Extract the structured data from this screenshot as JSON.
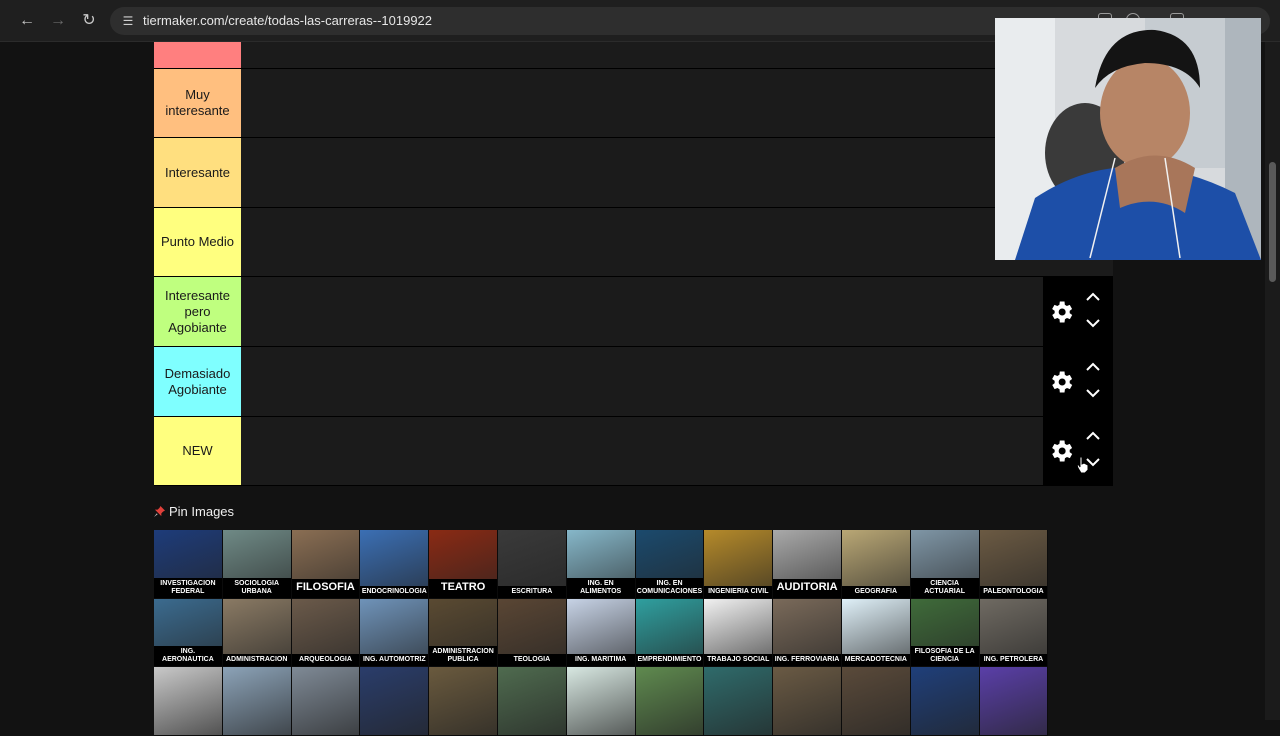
{
  "browser": {
    "url": "tiermaker.com/create/todas-las-carreras--1019922",
    "colors": {
      "chrome_bg": "#1f1f1f",
      "omnibox": "#2e2e2e"
    }
  },
  "tiers": [
    {
      "label": "",
      "color": "#ff7f7f",
      "controls_visible": false
    },
    {
      "label": "Muy interesante",
      "color": "#ffbf7f",
      "controls_visible": false
    },
    {
      "label": "Interesante",
      "color": "#ffdf7f",
      "controls_visible": false
    },
    {
      "label": "Punto Medio",
      "color": "#ffff7f",
      "controls_visible": false
    },
    {
      "label": "Interesante pero Agobiante",
      "color": "#bfff7f",
      "controls_visible": true
    },
    {
      "label": "Demasiado Agobiante",
      "color": "#7fffff",
      "controls_visible": true
    },
    {
      "label": "NEW",
      "color": "#ffff7f",
      "controls_visible": true
    }
  ],
  "pin_images_label": "Pin Images",
  "images": [
    {
      "caption": "INVESTIGACION FEDERAL",
      "bg": "#1e3c7a",
      "big": false
    },
    {
      "caption": "SOCIOLOGIA URBANA",
      "bg": "#6f8a86",
      "big": false
    },
    {
      "caption": "FILOSOFIA",
      "bg": "#8a6e53",
      "big": true
    },
    {
      "caption": "ENDOCRINOLOGIA",
      "bg": "#3b6fb4",
      "big": false
    },
    {
      "caption": "TEATRO",
      "bg": "#8a2a14",
      "big": true
    },
    {
      "caption": "ESCRITURA",
      "bg": "#3a3a3a",
      "big": false
    },
    {
      "caption": "ING. EN ALIMENTOS",
      "bg": "#86b7c9",
      "big": false
    },
    {
      "caption": "ING. EN COMUNICACIONES",
      "bg": "#1b4a6d",
      "big": false
    },
    {
      "caption": "INGENIERIA CIVIL",
      "bg": "#b58a2a",
      "big": false
    },
    {
      "caption": "AUDITORIA",
      "bg": "#a9a9a9",
      "big": true
    },
    {
      "caption": "GEOGRAFIA",
      "bg": "#b9a775",
      "big": false
    },
    {
      "caption": "CIENCIA ACTUARIAL",
      "bg": "#7f96a6",
      "big": false
    },
    {
      "caption": "PALEONTOLOGIA",
      "bg": "#6b5a43",
      "big": false
    },
    {
      "caption": "ING. AERONAUTICA",
      "bg": "#3b6b8f",
      "big": false
    },
    {
      "caption": "ADMINISTRACION",
      "bg": "#8a7a64",
      "big": false
    },
    {
      "caption": "ARQUEOLOGIA",
      "bg": "#6b5a4a",
      "big": false
    },
    {
      "caption": "ING. AUTOMOTRIZ",
      "bg": "#6f93b9",
      "big": false
    },
    {
      "caption": "ADMINISTRACION PUBLICA",
      "bg": "#5a4a32",
      "big": false
    },
    {
      "caption": "TEOLOGIA",
      "bg": "#5a4634",
      "big": false
    },
    {
      "caption": "ING. MARITIMA",
      "bg": "#c7d3e6",
      "big": false
    },
    {
      "caption": "EMPRENDIMIENTO",
      "bg": "#2f9f9f",
      "big": false
    },
    {
      "caption": "TRABAJO SOCIAL",
      "bg": "#f1f1f1",
      "big": false
    },
    {
      "caption": "ING. FERROVIARIA",
      "bg": "#7a6a5a",
      "big": false
    },
    {
      "caption": "MERCADOTECNIA",
      "bg": "#dff0f8",
      "big": false
    },
    {
      "caption": "FILOSOFIA DE LA CIENCIA",
      "bg": "#3f6b3a",
      "big": false
    },
    {
      "caption": "ING. PETROLERA",
      "bg": "#6f6a62",
      "big": false
    },
    {
      "caption": "",
      "bg": "#c9c9c9",
      "big": false
    },
    {
      "caption": "",
      "bg": "#8ca3b8",
      "big": false
    },
    {
      "caption": "",
      "bg": "#7f8a96",
      "big": false
    },
    {
      "caption": "",
      "bg": "#2a3d6b",
      "big": false
    },
    {
      "caption": "",
      "bg": "#6a5a3e",
      "big": false
    },
    {
      "caption": "",
      "bg": "#4f6b4f",
      "big": false
    },
    {
      "caption": "",
      "bg": "#d8e8e2",
      "big": false
    },
    {
      "caption": "",
      "bg": "#5f8a4f",
      "big": false
    },
    {
      "caption": "",
      "bg": "#2f6b6b",
      "big": false
    },
    {
      "caption": "",
      "bg": "#6a5a44",
      "big": false
    },
    {
      "caption": "",
      "bg": "#5a4a3a",
      "big": false
    },
    {
      "caption": "",
      "bg": "#1f3f7a",
      "big": false
    },
    {
      "caption": "",
      "bg": "#5a3fa8",
      "big": false
    }
  ]
}
